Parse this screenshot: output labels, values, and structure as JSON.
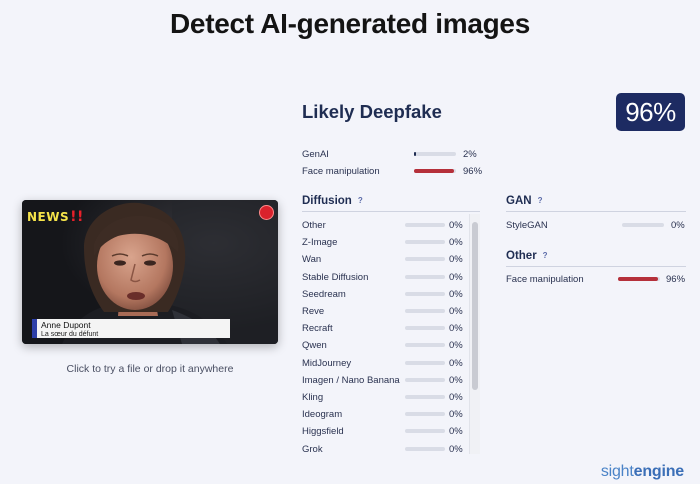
{
  "page": {
    "title": "Detect AI-generated images"
  },
  "upload": {
    "hint": "Click to try a file or drop it anywhere",
    "image": {
      "news_label": "NEWS",
      "news_bang": "!!",
      "caption_name": "Anne Dupont",
      "caption_sub": "La sœur du défunt"
    }
  },
  "result": {
    "verdict": "Likely Deepfake",
    "score": "96%",
    "summary": [
      {
        "label": "GenAI",
        "pct": "2%",
        "value": 0.02,
        "color": "#1f2d52"
      },
      {
        "label": "Face manipulation",
        "pct": "96%",
        "value": 0.96,
        "color": "#b5303a"
      }
    ]
  },
  "diffusion": {
    "title": "Diffusion",
    "help": "?",
    "items": [
      {
        "label": "Other",
        "pct": "0%",
        "value": 0
      },
      {
        "label": "Z-Image",
        "pct": "0%",
        "value": 0
      },
      {
        "label": "Wan",
        "pct": "0%",
        "value": 0
      },
      {
        "label": "Stable Diffusion",
        "pct": "0%",
        "value": 0
      },
      {
        "label": "Seedream",
        "pct": "0%",
        "value": 0
      },
      {
        "label": "Reve",
        "pct": "0%",
        "value": 0
      },
      {
        "label": "Recraft",
        "pct": "0%",
        "value": 0
      },
      {
        "label": "Qwen",
        "pct": "0%",
        "value": 0
      },
      {
        "label": "MidJourney",
        "pct": "0%",
        "value": 0
      },
      {
        "label": "Imagen / Nano Banana",
        "pct": "0%",
        "value": 0
      },
      {
        "label": "Kling",
        "pct": "0%",
        "value": 0
      },
      {
        "label": "Ideogram",
        "pct": "0%",
        "value": 0
      },
      {
        "label": "Higgsfield",
        "pct": "0%",
        "value": 0
      },
      {
        "label": "Grok",
        "pct": "0%",
        "value": 0
      }
    ]
  },
  "gan": {
    "title": "GAN",
    "help": "?",
    "items": [
      {
        "label": "StyleGAN",
        "pct": "0%",
        "value": 0
      }
    ]
  },
  "other": {
    "title": "Other",
    "help": "?",
    "items": [
      {
        "label": "Face manipulation",
        "pct": "96%",
        "value": 0.96,
        "color": "#b5303a"
      }
    ]
  },
  "brand": {
    "part1": "sight",
    "part2": "engine",
    "color": "#4a83c7"
  }
}
